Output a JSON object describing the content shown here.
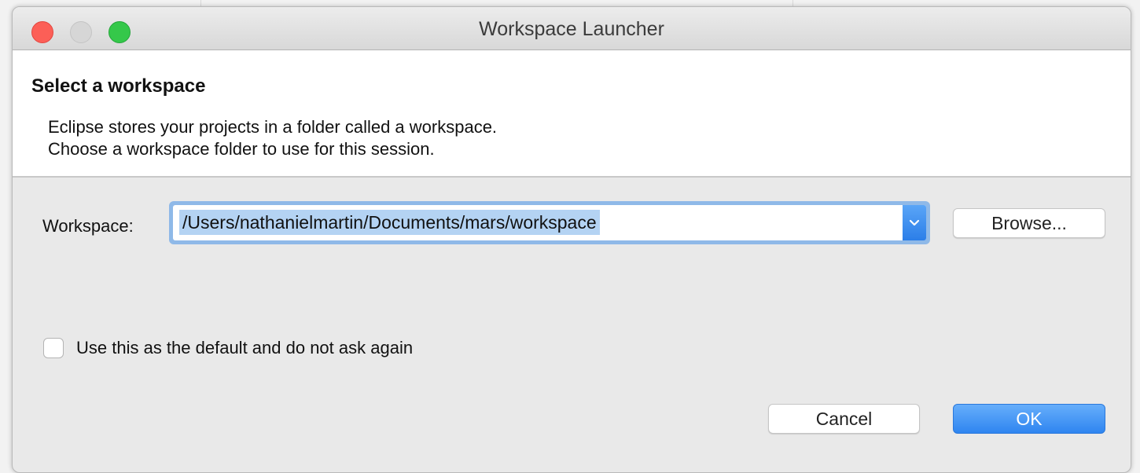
{
  "window": {
    "title": "Workspace Launcher"
  },
  "header": {
    "title": "Select a workspace",
    "description_line1": "Eclipse stores your projects in a folder called a workspace.",
    "description_line2": "Choose a workspace folder to use for this session."
  },
  "workspace": {
    "label": "Workspace:",
    "value": "/Users/nathanielmartin/Documents/mars/workspace",
    "browse_label": "Browse..."
  },
  "default_option": {
    "label": "Use this as the default and do not ask again",
    "checked": false
  },
  "footer": {
    "cancel_label": "Cancel",
    "ok_label": "OK"
  },
  "colors": {
    "accent": "#2f85f0",
    "selection": "#b4d3f3",
    "close": "#fc5f57",
    "maximize": "#35c84a"
  }
}
